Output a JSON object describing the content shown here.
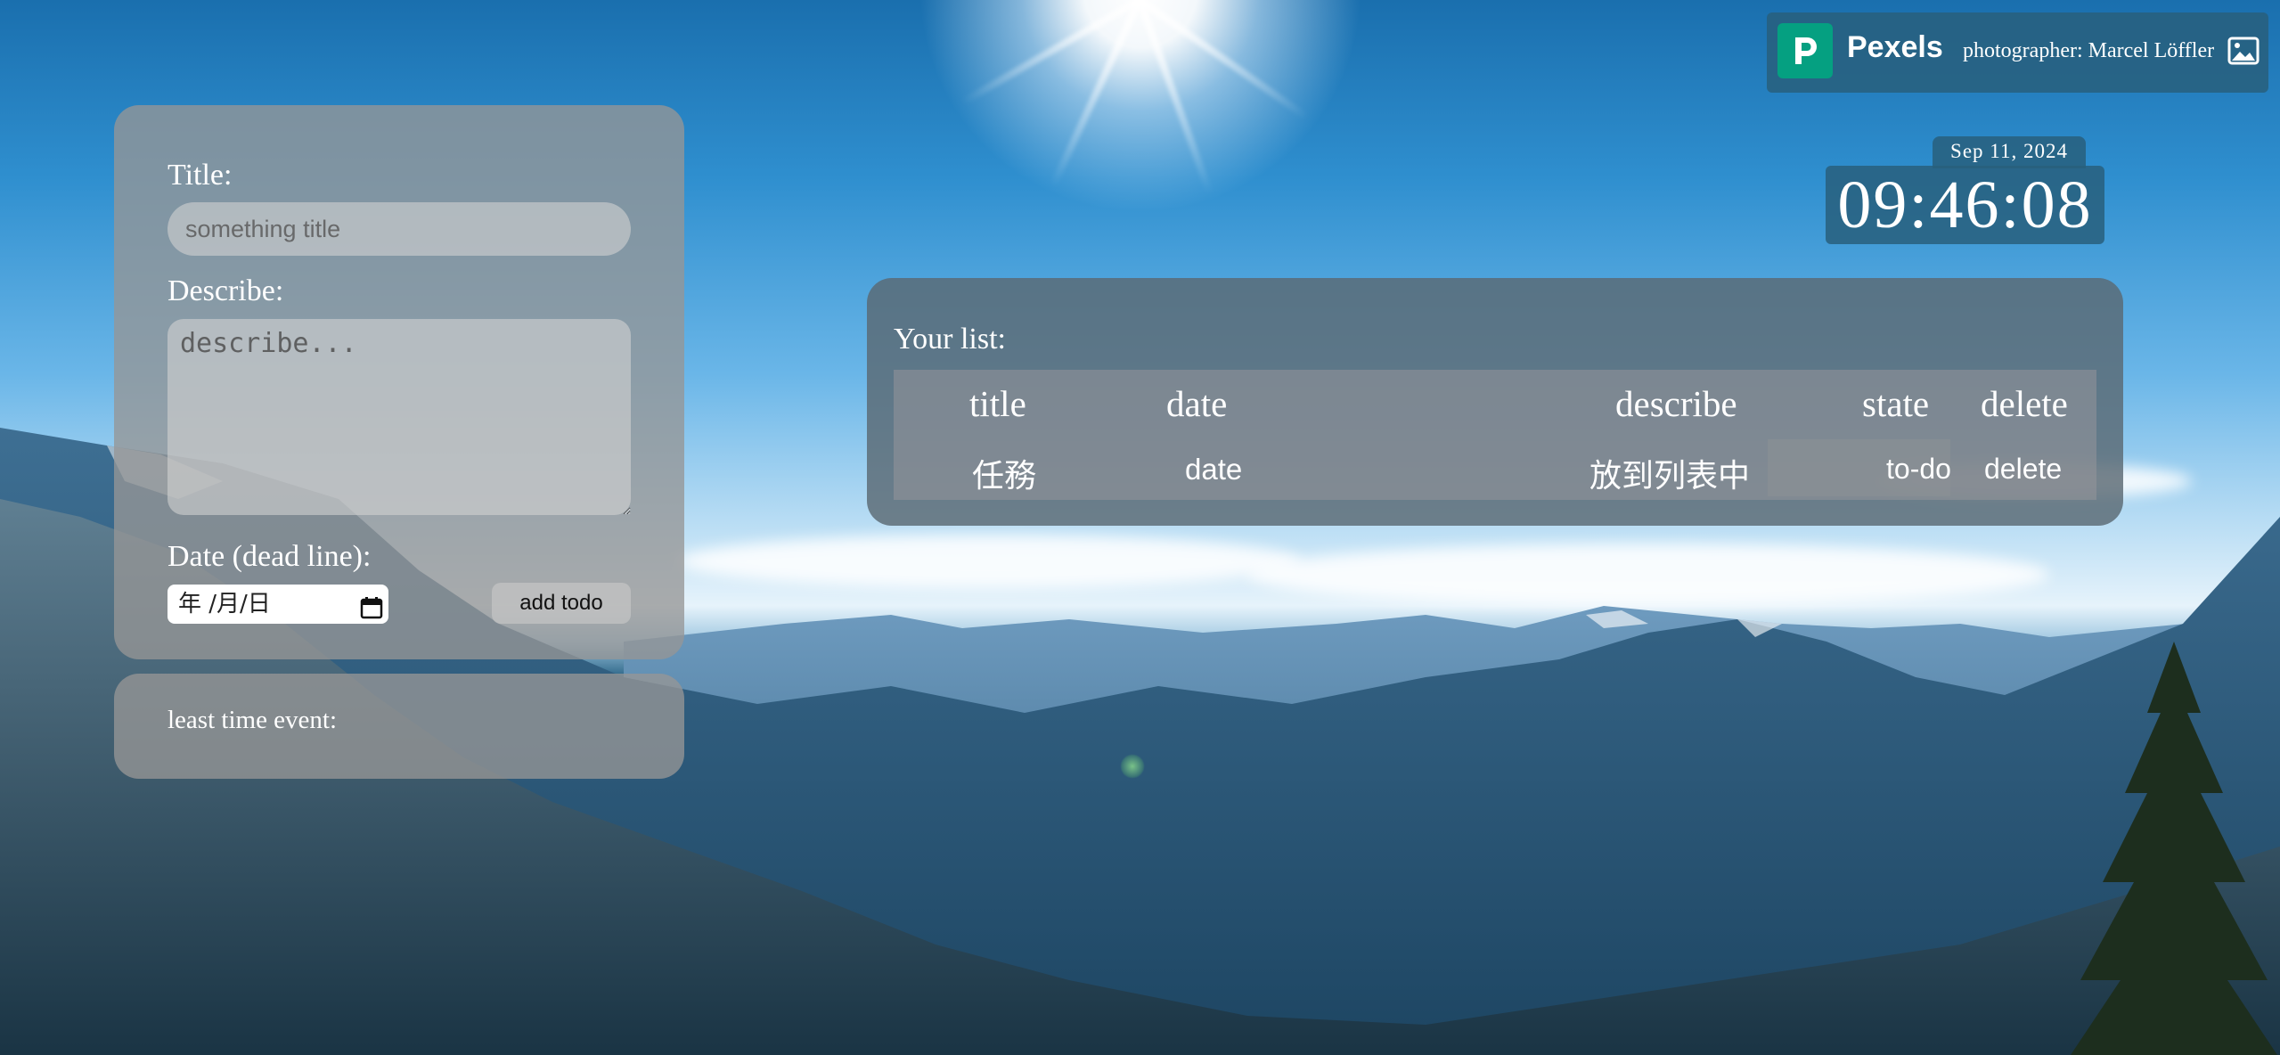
{
  "colors": {
    "panel_bg": "#969696",
    "list_panel_bg": "#5a6973",
    "pexels_green": "#05a081",
    "badge_bg": "#285f7d",
    "text": "#ffffff"
  },
  "attribution": {
    "brand": "Pexels",
    "photographer": "photographer: Marcel Löffler",
    "logo_icon": "pexels-logo-icon",
    "image_icon": "image-icon"
  },
  "clock": {
    "date": "Sep 11, 2024",
    "time": "09:46:08"
  },
  "form": {
    "title_label": "Title:",
    "title_placeholder": "something title",
    "title_value": "",
    "describe_label": "Describe:",
    "describe_placeholder": "describe...",
    "describe_value": "",
    "date_label": "Date (dead line):",
    "date_display": "年 /月/日",
    "calendar_icon": "calendar-icon",
    "add_button_label": "add todo"
  },
  "least_event": {
    "label": "least time event:"
  },
  "list": {
    "title": "Your list:",
    "columns": [
      "title",
      "date",
      "describe",
      "state",
      "delete"
    ],
    "rows": [
      {
        "title": "任務",
        "date": "date",
        "describe": "放到列表中",
        "state": "to-do",
        "delete": "delete"
      }
    ]
  }
}
